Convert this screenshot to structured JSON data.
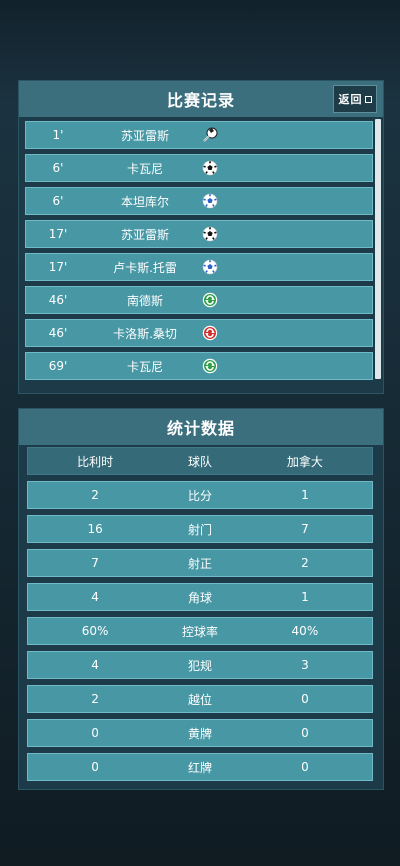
{
  "events_panel": {
    "title": "比赛记录",
    "back_label": "返回",
    "events": [
      {
        "time": "1'",
        "player": "苏亚雷斯",
        "icon": "whistle-icon"
      },
      {
        "time": "6'",
        "player": "卡瓦尼",
        "icon": "ball-black-icon"
      },
      {
        "time": "6'",
        "player": "本坦库尔",
        "icon": "ball-blue-icon"
      },
      {
        "time": "17'",
        "player": "苏亚雷斯",
        "icon": "ball-black-icon"
      },
      {
        "time": "17'",
        "player": "卢卡斯.托雷",
        "icon": "ball-blue-icon"
      },
      {
        "time": "46'",
        "player": "南德斯",
        "icon": "sub-in-icon"
      },
      {
        "time": "46'",
        "player": "卡洛斯.桑切",
        "icon": "sub-out-icon"
      },
      {
        "time": "69'",
        "player": "卡瓦尼",
        "icon": "sub-in-icon"
      }
    ]
  },
  "stats_panel": {
    "title": "统计数据",
    "team_home": "比利时",
    "team_label": "球队",
    "team_away": "加拿大",
    "rows": [
      {
        "home": "2",
        "label": "比分",
        "away": "1"
      },
      {
        "home": "16",
        "label": "射门",
        "away": "7"
      },
      {
        "home": "7",
        "label": "射正",
        "away": "2"
      },
      {
        "home": "4",
        "label": "角球",
        "away": "1"
      },
      {
        "home": "60%",
        "label": "控球率",
        "away": "40%"
      },
      {
        "home": "4",
        "label": "犯规",
        "away": "3"
      },
      {
        "home": "2",
        "label": "越位",
        "away": "0"
      },
      {
        "home": "0",
        "label": "黄牌",
        "away": "0"
      },
      {
        "home": "0",
        "label": "红牌",
        "away": "0"
      }
    ]
  },
  "colors": {
    "row_bg": "#4797a5",
    "header_bg": "#3b6f7e",
    "panel_bg": "#1c3a47",
    "sub_in": "#2e9e4a",
    "sub_out": "#d0322f"
  }
}
